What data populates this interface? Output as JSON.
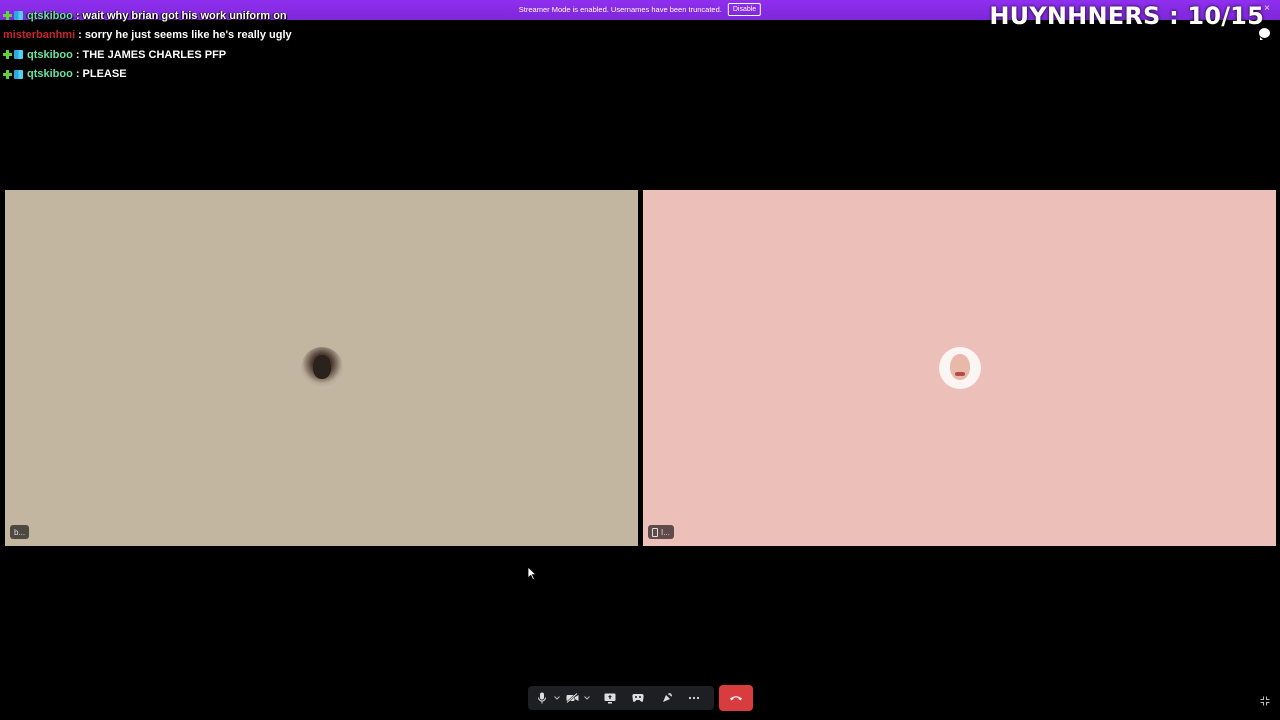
{
  "banner": {
    "text": "Streamer Mode is enabled. Usernames have been truncated.",
    "disable_label": "Disable",
    "close_glyph": "×"
  },
  "score": {
    "text": "HUYNHNERS : 10/15"
  },
  "chat": {
    "messages": [
      {
        "user": "qtskiboo",
        "separator": ":",
        "text": "wait why brian got his work uniform on",
        "user_color": "#6be3a0"
      },
      {
        "user": "misterbanhmi",
        "separator": ":",
        "text": "sorry he just seems like he's really ugly",
        "user_color": "#c8232c"
      },
      {
        "user": "qtskiboo",
        "separator": ":",
        "text": "THE JAMES CHARLES PFP",
        "user_color": "#6be3a0"
      },
      {
        "user": "qtskiboo",
        "separator": ":",
        "text": "PLEASE",
        "user_color": "#6be3a0"
      }
    ]
  },
  "tiles": [
    {
      "tag": "b...",
      "background": "#c2b6a0"
    },
    {
      "tag": "I...",
      "background": "#edbfb9"
    }
  ],
  "toolbar": {
    "icons": [
      "microphone-icon",
      "camera-off-icon",
      "screen-share-icon",
      "activity-icon",
      "soundboard-icon",
      "more-icon"
    ],
    "hangup_color": "#d83c3e"
  },
  "colors": {
    "banner": "#8a2be2",
    "background": "#000000"
  }
}
